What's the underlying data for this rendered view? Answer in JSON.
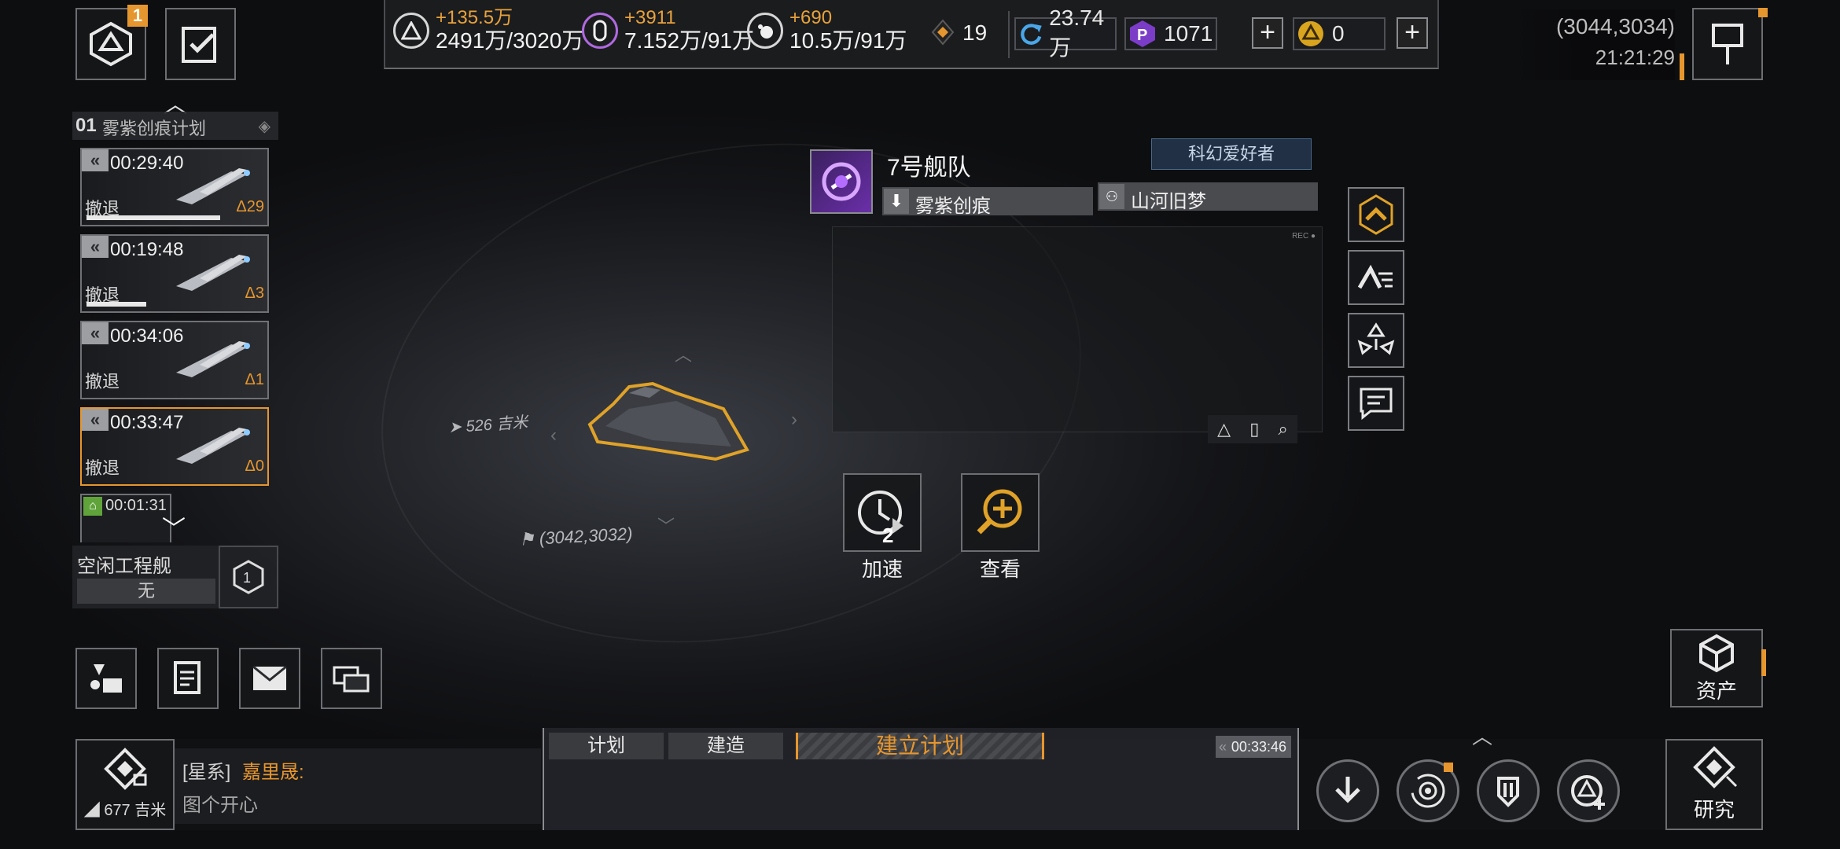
{
  "top_left": {
    "badge_count": "1"
  },
  "resources": [
    {
      "gain": "+135.5万",
      "value": "2491万/3020万",
      "icon": "triangle-icon"
    },
    {
      "gain": "+3911",
      "value": "7.152万/91万",
      "icon": "crystal-icon"
    },
    {
      "gain": "+690",
      "value": "10.5万/91万",
      "icon": "gas-icon"
    }
  ],
  "gem_count": "19",
  "energy": "23.74万",
  "premium": "1071",
  "gold": "0",
  "coords_top": "(3044,3034)",
  "clock": "21:21:29",
  "mission_group": {
    "index": "01",
    "title": "雾紫创痕计划"
  },
  "missions": [
    {
      "time": "00:29:40",
      "status": "撤退",
      "count": "Δ29",
      "progress": 0.74
    },
    {
      "time": "00:19:48",
      "status": "撤退",
      "count": "Δ3",
      "progress": 0.3
    },
    {
      "time": "00:34:06",
      "status": "撤退",
      "count": "Δ1",
      "progress": 0
    },
    {
      "time": "00:33:47",
      "status": "撤退",
      "count": "Δ0",
      "progress": 0
    },
    {
      "time": "00:01:31",
      "status": "",
      "count": "",
      "progress": 0
    }
  ],
  "idle_ships": {
    "label": "空闲工程舰",
    "value": "无"
  },
  "fleet": {
    "name": "7号舰队",
    "tag": "科幻爱好者",
    "faction": "雾紫创痕",
    "player": "山河旧梦"
  },
  "map": {
    "distance": "526 吉米",
    "ship_coords": "(3042,3032)"
  },
  "actions": [
    {
      "label": "加速",
      "count": "2"
    },
    {
      "label": "查看"
    }
  ],
  "assets_label": "资产",
  "research_label": "研究",
  "chat": {
    "channel": "[星系]",
    "sender": "嘉里晟:",
    "message": "图个开心",
    "distance": "677 吉米"
  },
  "build_tabs": {
    "plan": "计划",
    "build": "建造",
    "create_plan": "建立计划",
    "timer": "00:33:46"
  },
  "colors": {
    "accent": "#e6962e",
    "purple": "#8a3fd1"
  }
}
